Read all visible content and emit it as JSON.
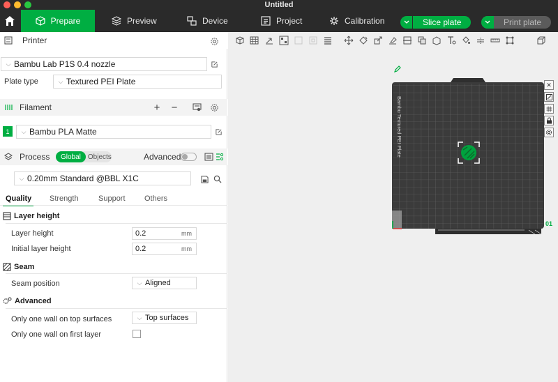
{
  "window": {
    "title": "Untitled"
  },
  "nav": {
    "tabs": [
      {
        "label": "Prepare",
        "active": true
      },
      {
        "label": "Preview"
      },
      {
        "label": "Device"
      },
      {
        "label": "Project"
      },
      {
        "label": "Calibration"
      }
    ],
    "slice_label": "Slice plate",
    "print_label": "Print plate"
  },
  "printer": {
    "section_label": "Printer",
    "model": "Bambu Lab P1S 0.4 nozzle",
    "plate_type_label": "Plate type",
    "plate_type": "Textured PEI Plate"
  },
  "filament": {
    "section_label": "Filament",
    "slot_number": "1",
    "slot_color": "#00ae42",
    "name": "Bambu PLA Matte"
  },
  "process": {
    "section_label": "Process",
    "scope_global": "Global",
    "scope_objects": "Objects",
    "advanced_label": "Advanced",
    "advanced_on": false,
    "preset": "0.20mm Standard @BBL X1C"
  },
  "settings_tabs": [
    {
      "label": "Quality",
      "active": true
    },
    {
      "label": "Strength"
    },
    {
      "label": "Support"
    },
    {
      "label": "Others"
    }
  ],
  "groups": {
    "layer_height": {
      "title": "Layer height",
      "layer_height_label": "Layer height",
      "layer_height_value": "0.2",
      "layer_height_unit": "mm",
      "initial_label": "Initial layer height",
      "initial_value": "0.2",
      "initial_unit": "mm"
    },
    "seam": {
      "title": "Seam",
      "position_label": "Seam position",
      "position_value": "Aligned"
    },
    "advanced": {
      "title": "Advanced",
      "one_wall_top_label": "Only one wall on top surfaces",
      "one_wall_top_value": "Top surfaces",
      "one_wall_first_label": "Only one wall on first layer",
      "one_wall_first_checked": false
    }
  },
  "viewport": {
    "plate_label": "Bambu Textured PEI Plate",
    "plate_number": "01",
    "accent": "#00ae42"
  }
}
